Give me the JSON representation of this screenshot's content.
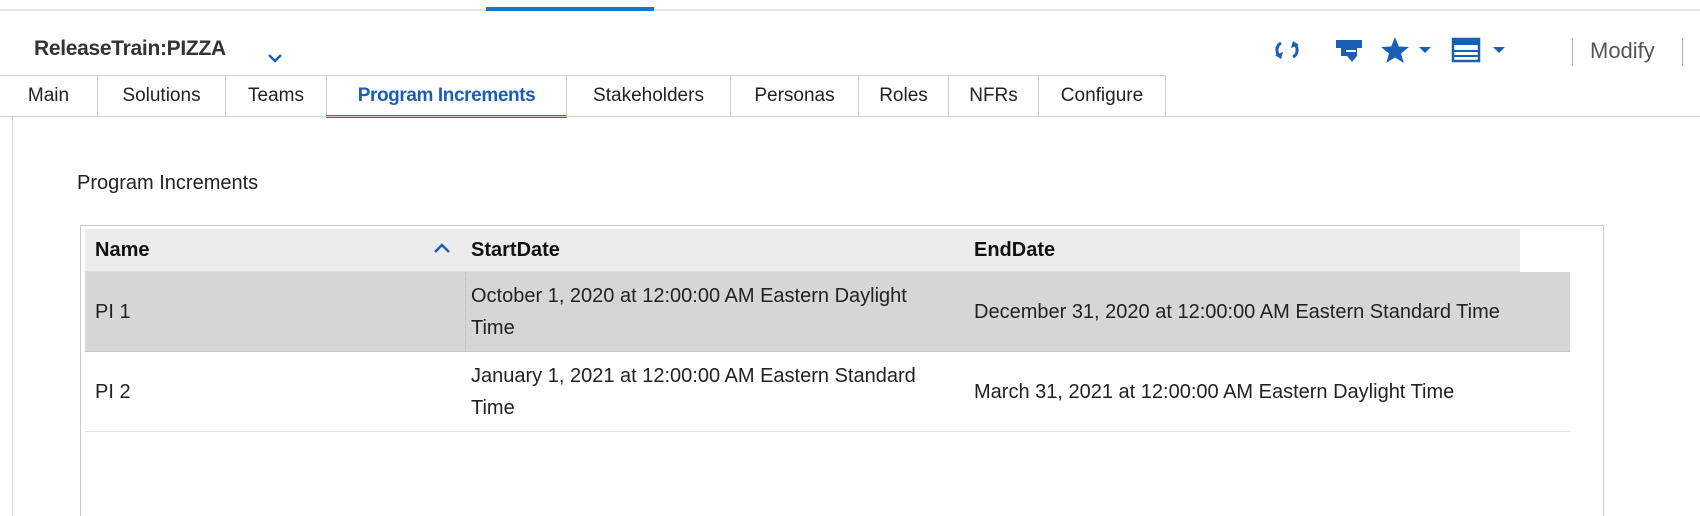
{
  "header": {
    "title": "ReleaseTrain:PIZZA",
    "modify_label": "Modify"
  },
  "toolbar": {
    "icons": [
      "refresh-icon",
      "tag-icon",
      "star-icon",
      "chevron-down-icon",
      "table-layout-icon",
      "chevron-down-icon"
    ]
  },
  "tabs": [
    {
      "label": "Main",
      "active": false
    },
    {
      "label": "Solutions",
      "active": false
    },
    {
      "label": "Teams",
      "active": false
    },
    {
      "label": "Program Increments",
      "active": true
    },
    {
      "label": "Stakeholders",
      "active": false
    },
    {
      "label": "Personas",
      "active": false
    },
    {
      "label": "Roles",
      "active": false
    },
    {
      "label": "NFRs",
      "active": false
    },
    {
      "label": "Configure",
      "active": false
    }
  ],
  "section": {
    "label": "Program Increments"
  },
  "table": {
    "columns": [
      "Name",
      "StartDate",
      "EndDate"
    ],
    "sort": {
      "column": "Name",
      "direction": "ascending"
    },
    "rows": [
      {
        "name": "PI 1",
        "start_date": "October 1, 2020 at 12:00:00 AM Eastern Daylight Time",
        "end_date": "December 31, 2020 at 12:00:00 AM Eastern Standard Time",
        "selected": true
      },
      {
        "name": "PI 2",
        "start_date": "January 1, 2021 at 12:00:00 AM Eastern Standard Time",
        "end_date": "March 31, 2021 at 12:00:00 AM Eastern Daylight Time",
        "selected": false
      }
    ]
  },
  "colors": {
    "accent": "#1a73c9",
    "active_tab_text": "#1a5fb4",
    "selected_row": "#d6d6d6",
    "header_bg": "#ececec"
  }
}
